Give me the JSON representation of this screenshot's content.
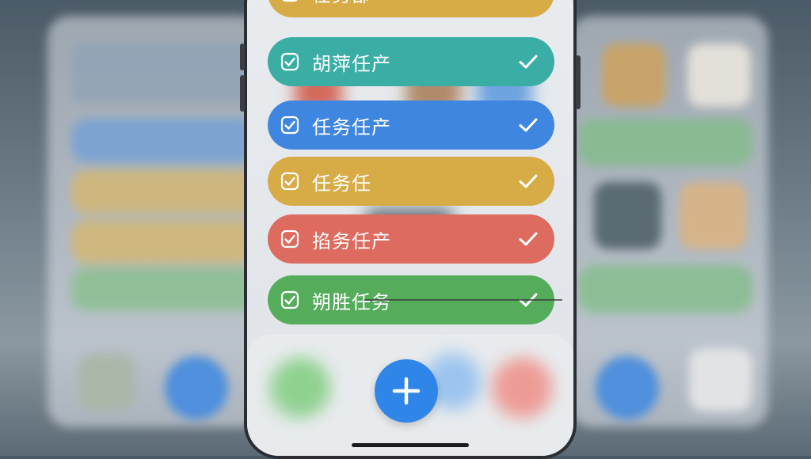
{
  "colors": {
    "teal": "#3aaea5",
    "blue": "#3f86e0",
    "yellow": "#d7ab45",
    "red": "#dd6b5f",
    "green": "#55ad5b",
    "add_button": "#2f86e8"
  },
  "tasks": [
    {
      "label": "任务部",
      "color": "yellow",
      "done": true
    },
    {
      "label": "胡萍任产",
      "color": "teal",
      "done": true
    },
    {
      "label": "任务任产",
      "color": "blue",
      "done": true
    },
    {
      "label": "任务任",
      "color": "yellow",
      "done": true
    },
    {
      "label": "掐务任产",
      "color": "red",
      "done": true
    },
    {
      "label": "朔胜任务",
      "color": "green",
      "done": true
    }
  ],
  "add_button": {
    "icon": "plus-icon"
  }
}
